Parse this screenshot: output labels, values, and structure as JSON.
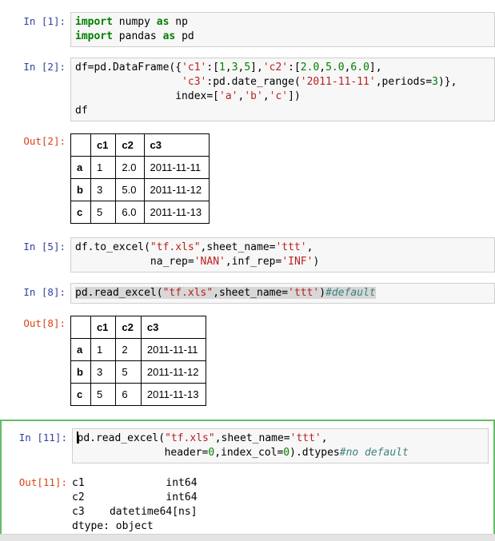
{
  "colors": {
    "keyword": "#008000",
    "string": "#BA2121",
    "number": "#008000",
    "comment": "#408080",
    "in_prompt": "#303F9F",
    "out_prompt": "#D84315",
    "selected_border": "#66BB6A",
    "input_bg": "#f7f7f7",
    "input_border": "#cfcfcf",
    "selection_highlight": "#d7d7d7"
  },
  "cells": [
    {
      "kind": "input",
      "prompt": "In [1]:",
      "lines": [
        [
          {
            "t": "import",
            "c": "kw"
          },
          {
            "t": " numpy "
          },
          {
            "t": "as",
            "c": "kw"
          },
          {
            "t": " np"
          }
        ],
        [
          {
            "t": "import",
            "c": "kw"
          },
          {
            "t": " pandas "
          },
          {
            "t": "as",
            "c": "kw"
          },
          {
            "t": " pd"
          }
        ]
      ]
    },
    {
      "kind": "input",
      "prompt": "In [2]:",
      "lines": [
        [
          {
            "t": "df=pd.DataFrame({"
          },
          {
            "t": "'c1'",
            "c": "str"
          },
          {
            "t": ":["
          },
          {
            "t": "1",
            "c": "num"
          },
          {
            "t": ","
          },
          {
            "t": "3",
            "c": "num"
          },
          {
            "t": ","
          },
          {
            "t": "5",
            "c": "num"
          },
          {
            "t": "],"
          },
          {
            "t": "'c2'",
            "c": "str"
          },
          {
            "t": ":["
          },
          {
            "t": "2.0",
            "c": "num"
          },
          {
            "t": ","
          },
          {
            "t": "5.0",
            "c": "num"
          },
          {
            "t": ","
          },
          {
            "t": "6.0",
            "c": "num"
          },
          {
            "t": "],"
          }
        ],
        [
          {
            "t": "                 "
          },
          {
            "t": "'c3'",
            "c": "str"
          },
          {
            "t": ":pd.date_range("
          },
          {
            "t": "'2011-11-11'",
            "c": "str"
          },
          {
            "t": ",periods="
          },
          {
            "t": "3",
            "c": "num"
          },
          {
            "t": ")},"
          }
        ],
        [
          {
            "t": "                index=["
          },
          {
            "t": "'a'",
            "c": "str"
          },
          {
            "t": ","
          },
          {
            "t": "'b'",
            "c": "str"
          },
          {
            "t": ","
          },
          {
            "t": "'c'",
            "c": "str"
          },
          {
            "t": "])"
          }
        ],
        [
          {
            "t": "df"
          }
        ]
      ]
    },
    {
      "kind": "table_output",
      "prompt": "Out[2]:",
      "headers": [
        "",
        "c1",
        "c2",
        "c3"
      ],
      "rows": [
        [
          "a",
          "1",
          "2.0",
          "2011-11-11"
        ],
        [
          "b",
          "3",
          "5.0",
          "2011-11-12"
        ],
        [
          "c",
          "5",
          "6.0",
          "2011-11-13"
        ]
      ]
    },
    {
      "kind": "input",
      "prompt": "In [5]:",
      "lines": [
        [
          {
            "t": "df.to_excel("
          },
          {
            "t": "\"tf.xls\"",
            "c": "str"
          },
          {
            "t": ",sheet_name="
          },
          {
            "t": "'ttt'",
            "c": "str"
          },
          {
            "t": ","
          }
        ],
        [
          {
            "t": "            na_rep="
          },
          {
            "t": "'NAN'",
            "c": "str"
          },
          {
            "t": ",inf_rep="
          },
          {
            "t": "'INF'",
            "c": "str"
          },
          {
            "t": ")"
          }
        ]
      ]
    },
    {
      "kind": "input",
      "prompt": "In [8]:",
      "highlight": true,
      "lines": [
        [
          {
            "t": "pd.read_excel("
          },
          {
            "t": "\"tf.xls\"",
            "c": "str"
          },
          {
            "t": ",sheet_name="
          },
          {
            "t": "'ttt'",
            "c": "str"
          },
          {
            "t": ")"
          },
          {
            "t": "#default",
            "c": "cmt"
          }
        ]
      ]
    },
    {
      "kind": "table_output",
      "prompt": "Out[8]:",
      "headers": [
        "",
        "c1",
        "c2",
        "c3"
      ],
      "rows": [
        [
          "a",
          "1",
          "2",
          "2011-11-11"
        ],
        [
          "b",
          "3",
          "5",
          "2011-11-12"
        ],
        [
          "c",
          "5",
          "6",
          "2011-11-13"
        ]
      ]
    },
    {
      "kind": "input",
      "prompt": "In [11]:",
      "selected": true,
      "cursor": true,
      "lines": [
        [
          {
            "t": "pd.read_excel("
          },
          {
            "t": "\"tf.xls\"",
            "c": "str"
          },
          {
            "t": ",sheet_name="
          },
          {
            "t": "'ttt'",
            "c": "str"
          },
          {
            "t": ","
          }
        ],
        [
          {
            "t": "              header="
          },
          {
            "t": "0",
            "c": "num"
          },
          {
            "t": ",index_col="
          },
          {
            "t": "0",
            "c": "num"
          },
          {
            "t": ").dtypes"
          },
          {
            "t": "#no default",
            "c": "cmt"
          }
        ]
      ]
    },
    {
      "kind": "text_output",
      "prompt": "Out[11]:",
      "selected": true,
      "lines": [
        "c1             int64",
        "c2             int64",
        "c3    datetime64[ns]",
        "dtype: object"
      ]
    }
  ]
}
